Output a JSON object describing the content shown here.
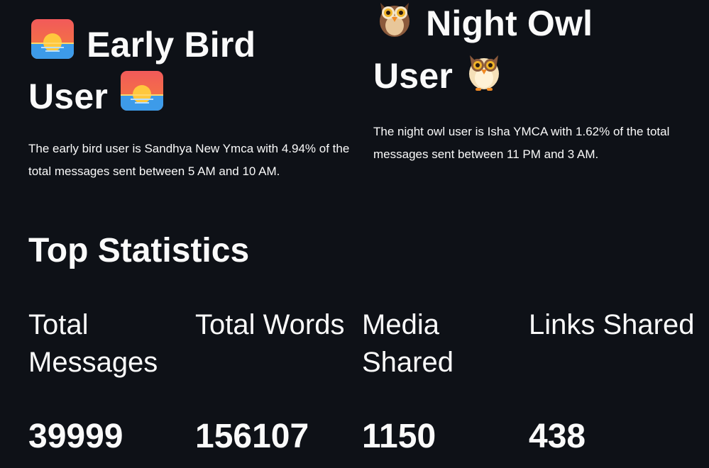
{
  "early_bird": {
    "title_line1": "Early Bird",
    "title_line2": "User",
    "icon": "sunrise-icon",
    "description": "The early bird user is Sandhya New Ymca with 4.94% of the total messages sent between 5 AM and 10 AM."
  },
  "night_owl": {
    "title_line1": "Night Owl",
    "title_line2": "User",
    "icon": "owl-icon",
    "description": "The night owl user is Isha YMCA with 1.62% of the total messages sent between 11 PM and 3 AM."
  },
  "top_statistics": {
    "title": "Top Statistics",
    "metrics": [
      {
        "label": "Total Messages",
        "value": "39999"
      },
      {
        "label": "Total Words",
        "value": "156107"
      },
      {
        "label": "Media Shared",
        "value": "1150"
      },
      {
        "label": "Links Shared",
        "value": "438"
      }
    ]
  },
  "colors": {
    "background": "#0e1117",
    "text": "#fafafa"
  }
}
